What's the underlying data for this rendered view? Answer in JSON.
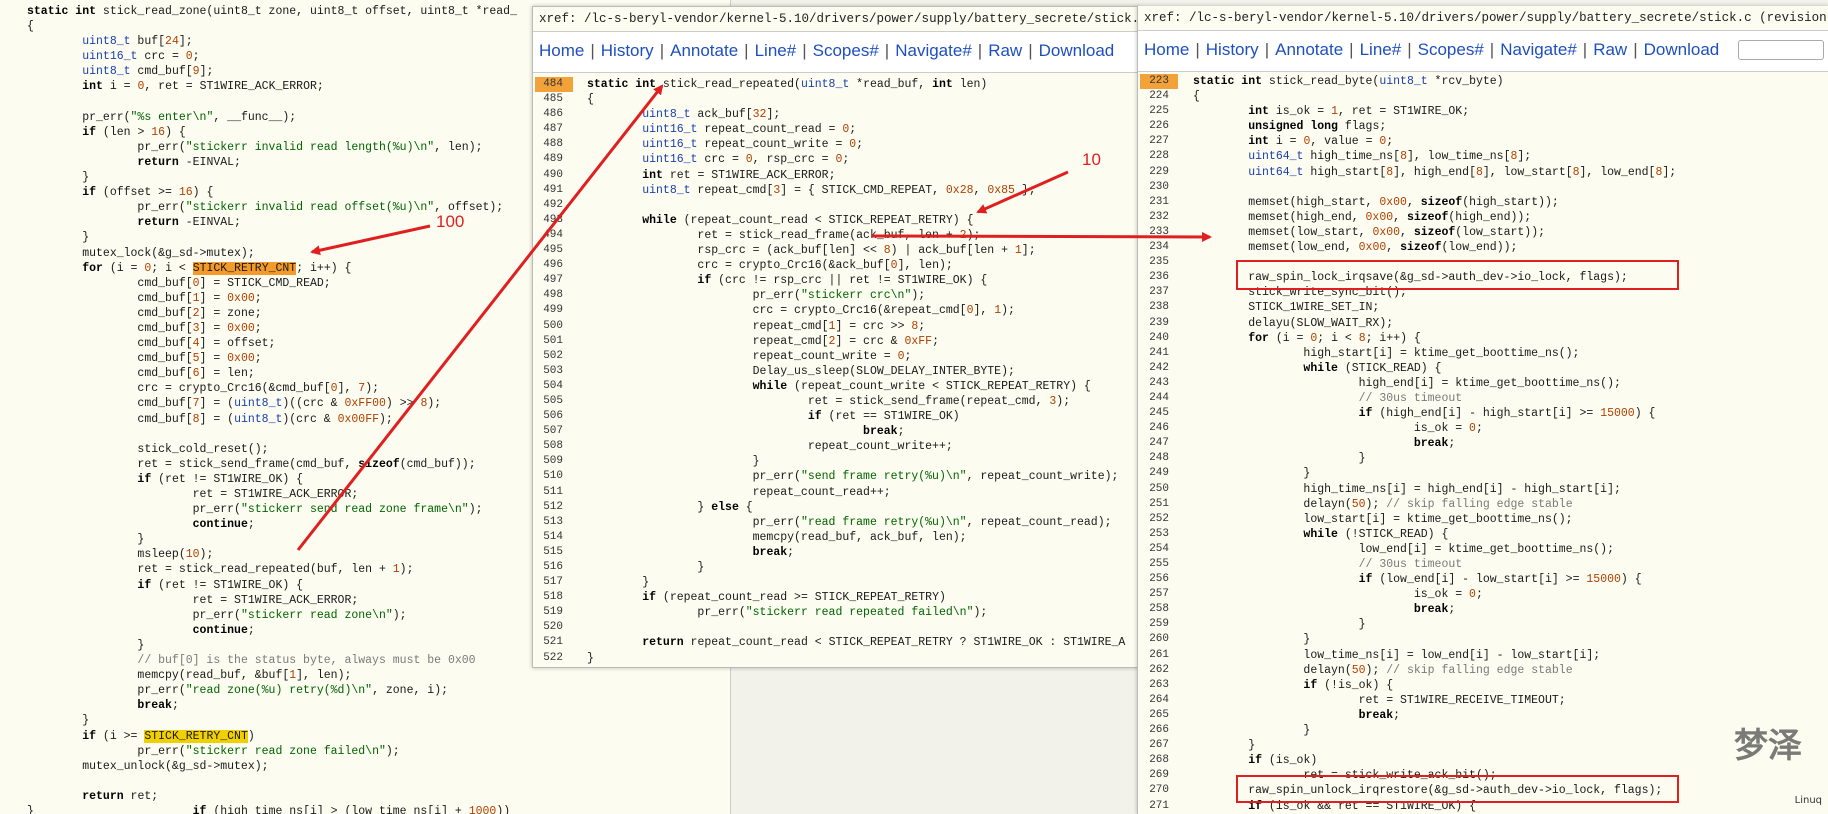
{
  "left_panel": {
    "lines": [
      "<span class=\"kw\">static int</span> stick_read_zone(uint8_t zone, uint8_t offset, uint8_t *read_",
      "{",
      "        <span class=\"ty\">uint8_t</span> buf[<span class=\"nu\">24</span>];",
      "        <span class=\"ty\">uint16_t</span> crc = <span class=\"nu\">0</span>;",
      "        <span class=\"ty\">uint8_t</span> cmd_buf[<span class=\"nu\">9</span>];",
      "        <span class=\"kw\">int</span> i = <span class=\"nu\">0</span>, ret = ST1WIRE_ACK_ERROR;",
      "",
      "        pr_err(<span class=\"st\">\"%s enter\\n\"</span>, __func__);",
      "        <span class=\"kw\">if</span> (len &gt; <span class=\"nu\">16</span>) {",
      "                pr_err(<span class=\"st\">\"stickerr invalid read length(%u)\\n\"</span>, len);",
      "                <span class=\"kw\">return</span> -EINVAL;",
      "        }",
      "        <span class=\"kw\">if</span> (offset &gt;= <span class=\"nu\">16</span>) {",
      "                pr_err(<span class=\"st\">\"stickerr invalid read offset(%u)\\n\"</span>, offset);",
      "                <span class=\"kw\">return</span> -EINVAL;",
      "        }",
      "        mutex_lock(&amp;g_sd-&gt;mutex);",
      "        <span class=\"kw\">for</span> (i = <span class=\"nu\">0</span>; i &lt; <span class=\"hlo\">STICK_RETRY_CNT</span>; i++) {",
      "                cmd_buf[<span class=\"nu\">0</span>] = STICK_CMD_READ;",
      "                cmd_buf[<span class=\"nu\">1</span>] = <span class=\"nu\">0x00</span>;",
      "                cmd_buf[<span class=\"nu\">2</span>] = zone;",
      "                cmd_buf[<span class=\"nu\">3</span>] = <span class=\"nu\">0x00</span>;",
      "                cmd_buf[<span class=\"nu\">4</span>] = offset;",
      "                cmd_buf[<span class=\"nu\">5</span>] = <span class=\"nu\">0x00</span>;",
      "                cmd_buf[<span class=\"nu\">6</span>] = len;",
      "                crc = crypto_Crc16(&amp;cmd_buf[<span class=\"nu\">0</span>], <span class=\"nu\">7</span>);",
      "                cmd_buf[<span class=\"nu\">7</span>] = (<span class=\"ty\">uint8_t</span>)((crc &amp; <span class=\"nu\">0xFF00</span>) &gt;&gt; <span class=\"nu\">8</span>);",
      "                cmd_buf[<span class=\"nu\">8</span>] = (<span class=\"ty\">uint8_t</span>)(crc &amp; <span class=\"nu\">0x00FF</span>);",
      "",
      "                stick_cold_reset();",
      "                ret = stick_send_frame(cmd_buf, <span class=\"kw\">sizeof</span>(cmd_buf));",
      "                <span class=\"kw\">if</span> (ret != ST1WIRE_OK) {",
      "                        ret = ST1WIRE_ACK_ERROR;",
      "                        pr_err(<span class=\"st\">\"stickerr send read zone frame\\n\"</span>);",
      "                        <span class=\"kw\">continue</span>;",
      "                }",
      "                msleep(<span class=\"nu\">10</span>);",
      "                ret = stick_read_repeated(buf, len + <span class=\"nu\">1</span>);",
      "                <span class=\"kw\">if</span> (ret != ST1WIRE_OK) {",
      "                        ret = ST1WIRE_ACK_ERROR;",
      "                        pr_err(<span class=\"st\">\"stickerr read zone\\n\"</span>);",
      "                        <span class=\"kw\">continue</span>;",
      "                }",
      "                <span class=\"cm\">// buf[0] is the status byte, always must be 0x00</span>",
      "                memcpy(read_buf, &amp;buf[<span class=\"nu\">1</span>], len);",
      "                pr_err(<span class=\"st\">\"read zone(%u) retry(%d)\\n\"</span>, zone, i);",
      "                <span class=\"kw\">break</span>;",
      "        }",
      "        <span class=\"kw\">if</span> (i &gt;= <span class=\"hl\">STICK_RETRY_CNT</span>)",
      "                pr_err(<span class=\"st\">\"stickerr read zone failed\\n\"</span>);",
      "        mutex_unlock(&amp;g_sd-&gt;mutex);",
      "",
      "        <span class=\"kw\">return</span> ret;",
      "}                       <span class=\"kw\">if</span> (high_time_ns[i] &gt; (low_time_ns[i] + <span class=\"nu\">1000</span>))"
    ]
  },
  "mid_panel": {
    "title": "xref: /lc-s-beryl-vendor/kernel-5.10/drivers/power/supply/battery_secrete/stick.c (rev",
    "nav": [
      "Home",
      "History",
      "Annotate",
      "Line#",
      "Scopes#",
      "Navigate#",
      "Raw",
      "Download"
    ],
    "line_numbers": [
      "484",
      "485",
      "486",
      "487",
      "488",
      "489",
      "490",
      "491",
      "492",
      "493",
      "494",
      "495",
      "496",
      "497",
      "498",
      "499",
      "500",
      "501",
      "502",
      "503",
      "504",
      "505",
      "506",
      "507",
      "508",
      "509",
      "510",
      "511",
      "512",
      "513",
      "514",
      "515",
      "516",
      "517",
      "518",
      "519",
      "520",
      "521",
      "522"
    ],
    "lines": [
      "<span class=\"kw\">static int</span> stick_read_repeated(<span class=\"ty\">uint8_t</span> *read_buf, <span class=\"kw\">int</span> len)",
      "{",
      "        <span class=\"ty\">uint8_t</span> ack_buf[<span class=\"nu\">32</span>];",
      "        <span class=\"ty\">uint16_t</span> repeat_count_read = <span class=\"nu\">0</span>;",
      "        <span class=\"ty\">uint16_t</span> repeat_count_write = <span class=\"nu\">0</span>;",
      "        <span class=\"ty\">uint16_t</span> crc = <span class=\"nu\">0</span>, rsp_crc = <span class=\"nu\">0</span>;",
      "        <span class=\"kw\">int</span> ret = ST1WIRE_ACK_ERROR;",
      "        <span class=\"ty\">uint8_t</span> repeat_cmd[<span class=\"nu\">3</span>] = { STICK_CMD_REPEAT, <span class=\"nu\">0x28</span>, <span class=\"nu\">0x85</span> };",
      "",
      "        <span class=\"kw\">while</span> (repeat_count_read &lt; STICK_REPEAT_RETRY) {",
      "                ret = stick_read_frame(ack_buf, len + <span class=\"nu\">2</span>);",
      "                rsp_crc = (ack_buf[len] &lt;&lt; <span class=\"nu\">8</span>) | ack_buf[len + <span class=\"nu\">1</span>];",
      "                crc = crypto_Crc16(&amp;ack_buf[<span class=\"nu\">0</span>], len);",
      "                <span class=\"kw\">if</span> (crc != rsp_crc || ret != ST1WIRE_OK) {",
      "                        pr_err(<span class=\"st\">\"stickerr crc\\n\"</span>);",
      "                        crc = crypto_Crc16(&amp;repeat_cmd[<span class=\"nu\">0</span>], <span class=\"nu\">1</span>);",
      "                        repeat_cmd[<span class=\"nu\">1</span>] = crc &gt;&gt; <span class=\"nu\">8</span>;",
      "                        repeat_cmd[<span class=\"nu\">2</span>] = crc &amp; <span class=\"nu\">0xFF</span>;",
      "                        repeat_count_write = <span class=\"nu\">0</span>;",
      "                        Delay_us_sleep(SLOW_DELAY_INTER_BYTE);",
      "                        <span class=\"kw\">while</span> (repeat_count_write &lt; STICK_REPEAT_RETRY) {",
      "                                ret = stick_send_frame(repeat_cmd, <span class=\"nu\">3</span>);",
      "                                <span class=\"kw\">if</span> (ret == ST1WIRE_OK)",
      "                                        <span class=\"kw\">break</span>;",
      "                                repeat_count_write++;",
      "                        }",
      "                        pr_err(<span class=\"st\">\"send frame retry(%u)\\n\"</span>, repeat_count_write);",
      "                        repeat_count_read++;",
      "                } <span class=\"kw\">else</span> {",
      "                        pr_err(<span class=\"st\">\"read frame retry(%u)\\n\"</span>, repeat_count_read);",
      "                        memcpy(read_buf, ack_buf, len);",
      "                        <span class=\"kw\">break</span>;",
      "                }",
      "        }",
      "        <span class=\"kw\">if</span> (repeat_count_read &gt;= STICK_REPEAT_RETRY)",
      "                pr_err(<span class=\"st\">\"stickerr read repeated failed\\n\"</span>);",
      "",
      "        <span class=\"kw\">return</span> repeat_count_read &lt; STICK_REPEAT_RETRY ? ST1WIRE_OK : ST1WIRE_A",
      "}"
    ]
  },
  "right_panel": {
    "title": "xref: /lc-s-beryl-vendor/kernel-5.10/drivers/power/supply/battery_secrete/stick.c (revision unkn",
    "nav": [
      "Home",
      "History",
      "Annotate",
      "Line#",
      "Scopes#",
      "Navigate#",
      "Raw",
      "Download"
    ],
    "line_numbers": [
      "223",
      "224",
      "225",
      "226",
      "227",
      "228",
      "229",
      "230",
      "231",
      "232",
      "233",
      "234",
      "235",
      "236",
      "237",
      "238",
      "239",
      "240",
      "241",
      "242",
      "243",
      "244",
      "245",
      "246",
      "247",
      "248",
      "249",
      "250",
      "251",
      "252",
      "253",
      "254",
      "255",
      "256",
      "257",
      "258",
      "259",
      "260",
      "261",
      "262",
      "263",
      "264",
      "265",
      "266",
      "267",
      "268",
      "269",
      "270",
      "271"
    ],
    "lines": [
      "<span class=\"kw\">static int</span> stick_read_byte(<span class=\"ty\">uint8_t</span> *rcv_byte)",
      "{",
      "        <span class=\"kw\">int</span> is_ok = <span class=\"nu\">1</span>, ret = ST1WIRE_OK;",
      "        <span class=\"kw\">unsigned long</span> flags;",
      "        <span class=\"kw\">int</span> i = <span class=\"nu\">0</span>, value = <span class=\"nu\">0</span>;",
      "        <span class=\"ty\">uint64_t</span> high_time_ns[<span class=\"nu\">8</span>], low_time_ns[<span class=\"nu\">8</span>];",
      "        <span class=\"ty\">uint64_t</span> high_start[<span class=\"nu\">8</span>], high_end[<span class=\"nu\">8</span>], low_start[<span class=\"nu\">8</span>], low_end[<span class=\"nu\">8</span>];",
      "",
      "        memset(high_start, <span class=\"nu\">0x00</span>, <span class=\"kw\">sizeof</span>(high_start));",
      "        memset(high_end, <span class=\"nu\">0x00</span>, <span class=\"kw\">sizeof</span>(high_end));",
      "        memset(low_start, <span class=\"nu\">0x00</span>, <span class=\"kw\">sizeof</span>(low_start));",
      "        memset(low_end, <span class=\"nu\">0x00</span>, <span class=\"kw\">sizeof</span>(low_end));",
      "",
      "        raw_spin_lock_irqsave(&amp;g_sd-&gt;auth_dev-&gt;io_lock, flags);",
      "        stick_write_sync_bit();",
      "        STICK_1WIRE_SET_IN;",
      "        delayu(SLOW_WAIT_RX);",
      "        <span class=\"kw\">for</span> (i = <span class=\"nu\">0</span>; i &lt; <span class=\"nu\">8</span>; i++) {",
      "                high_start[i] = ktime_get_boottime_ns();",
      "                <span class=\"kw\">while</span> (STICK_READ) {",
      "                        high_end[i] = ktime_get_boottime_ns();",
      "                        <span class=\"cm\">// 30us timeout</span>",
      "                        <span class=\"kw\">if</span> (high_end[i] - high_start[i] &gt;= <span class=\"nu\">15000</span>) {",
      "                                is_ok = <span class=\"nu\">0</span>;",
      "                                <span class=\"kw\">break</span>;",
      "                        }",
      "                }",
      "                high_time_ns[i] = high_end[i] - high_start[i];",
      "                delayn(<span class=\"nu\">50</span>); <span class=\"cm\">// skip falling edge stable</span>",
      "                low_start[i] = ktime_get_boottime_ns();",
      "                <span class=\"kw\">while</span> (!STICK_READ) {",
      "                        low_end[i] = ktime_get_boottime_ns();",
      "                        <span class=\"cm\">// 30us timeout</span>",
      "                        <span class=\"kw\">if</span> (low_end[i] - low_start[i] &gt;= <span class=\"nu\">15000</span>) {",
      "                                is_ok = <span class=\"nu\">0</span>;",
      "                                <span class=\"kw\">break</span>;",
      "                        }",
      "                }",
      "                low_time_ns[i] = low_end[i] - low_start[i];",
      "                delayn(<span class=\"nu\">50</span>); <span class=\"cm\">// skip falling edge stable</span>",
      "                <span class=\"kw\">if</span> (!is_ok) {",
      "                        ret = ST1WIRE_RECEIVE_TIMEOUT;",
      "                        <span class=\"kw\">break</span>;",
      "                }",
      "        }",
      "        <span class=\"kw\">if</span> (is_ok)",
      "                ret = stick_write_ack_bit();",
      "        raw_spin_unlock_irqrestore(&amp;g_sd-&gt;auth_dev-&gt;io_lock, flags);",
      "        <span class=\"kw\">if</span> (is_ok &amp;&amp; ret == ST1WIRE_OK) {"
    ]
  },
  "annotations": {
    "label_100": "100",
    "label_10": "10"
  },
  "watermark": {
    "glyph": "梦泽",
    "small": "Linuq"
  },
  "colors": {
    "arrow": "#e02020",
    "link": "#1e4fc0",
    "highlight_yellow": "#f0d000",
    "highlight_orange": "#f39a2a"
  }
}
